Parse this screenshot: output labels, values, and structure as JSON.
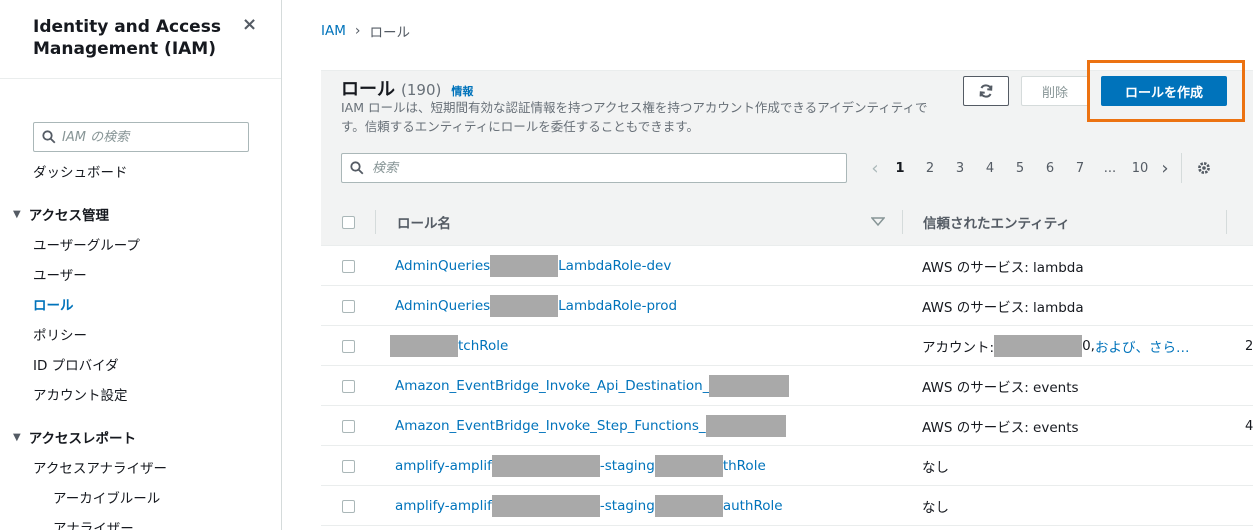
{
  "sidebar": {
    "title": "Identity and Access Management (IAM)",
    "close_icon": "×",
    "search_placeholder": "IAM の検索",
    "dashboard": "ダッシュボード",
    "section_access_mgmt": "アクセス管理",
    "items": [
      "ユーザーグループ",
      "ユーザー",
      "ロール",
      "ポリシー",
      "ID プロバイダ",
      "アカウント設定"
    ],
    "active_item": "ロール",
    "section_access_report": "アクセスレポート",
    "report_items": [
      "アクセスアナライザー",
      "アーカイブルール",
      "アナライザー"
    ]
  },
  "breadcrumb": {
    "root": "IAM",
    "current": "ロール"
  },
  "header": {
    "title": "ロール",
    "count": "(190)",
    "info": "情報",
    "description": "IAM ロールは、短期間有効な認証情報を持つアクセス権を持つアカウント作成できるアイデンティティです。信頼するエンティティにロールを委任することもできます。",
    "delete_label": "削除",
    "create_label": "ロールを作成",
    "search_placeholder": "検索"
  },
  "pagination": {
    "pages": [
      "1",
      "2",
      "3",
      "4",
      "5",
      "6",
      "7",
      "...",
      "10"
    ],
    "current": "1"
  },
  "table": {
    "col_role_name": "ロール名",
    "col_trusted": "信頼されたエンティティ",
    "rows": [
      {
        "name_pre": "AdminQueries",
        "name_post": "LambdaRole-dev",
        "trusted_pre": "AWS のサービス: lambda",
        "trusted_post": "",
        "trusted_more": "",
        "edge": ""
      },
      {
        "name_pre": "AdminQueries",
        "name_post": "LambdaRole-prod",
        "trusted_pre": "AWS のサービス: lambda",
        "trusted_post": "",
        "trusted_more": "",
        "edge": ""
      },
      {
        "name_pre": "",
        "name_post": "tchRole",
        "trusted_pre": "アカウント: ",
        "trusted_post": "0, ",
        "trusted_more": "および、さら…",
        "edge": "2"
      },
      {
        "name_pre": "Amazon_EventBridge_Invoke_Api_Destination_",
        "name_post": "",
        "trusted_pre": "AWS のサービス: events",
        "trusted_post": "",
        "trusted_more": "",
        "edge": ""
      },
      {
        "name_pre": "Amazon_EventBridge_Invoke_Step_Functions_",
        "name_post": "",
        "trusted_pre": "AWS のサービス: events",
        "trusted_post": "",
        "trusted_more": "",
        "edge": "4"
      },
      {
        "name_pre": "amplify-amplif",
        "name_mid": "-staging",
        "name_post": "thRole",
        "trusted_pre": "なし",
        "trusted_post": "",
        "trusted_more": "",
        "edge": ""
      },
      {
        "name_pre": "amplify-amplif",
        "name_mid": "-staging",
        "name_post": "authRole",
        "trusted_pre": "なし",
        "trusted_post": "",
        "trusted_more": "",
        "edge": ""
      }
    ]
  },
  "colors": {
    "accent": "#0073bb",
    "highlight": "#ec7211",
    "redaction": "#a9a9a9"
  }
}
